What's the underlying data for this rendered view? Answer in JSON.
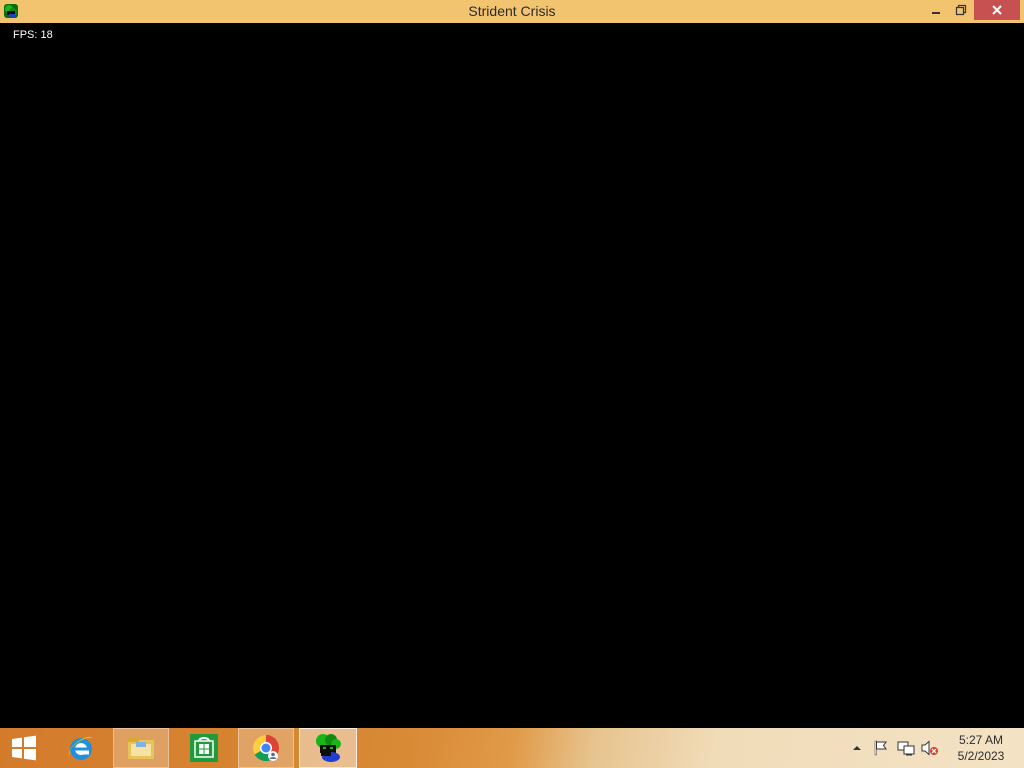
{
  "window": {
    "title": "Strident Crisis",
    "icon": "strident-crisis-app-icon"
  },
  "game": {
    "fps_label": "FPS:",
    "fps_value": "18"
  },
  "taskbar": {
    "start_icon": "windows-start-icon",
    "pinned": [
      {
        "name": "Internet Explorer",
        "icon": "internet-explorer-icon"
      },
      {
        "name": "File Explorer",
        "icon": "file-explorer-icon"
      },
      {
        "name": "Store",
        "icon": "store-icon"
      },
      {
        "name": "Google Chrome",
        "icon": "chrome-icon"
      },
      {
        "name": "Strident Crisis",
        "icon": "strident-crisis-icon"
      }
    ]
  },
  "tray": {
    "time": "5:27 AM",
    "date": "5/2/2023"
  },
  "colors": {
    "titlebar": "#f2c46f",
    "close_button": "#c75050",
    "taskbar_start": "#d37b2b",
    "taskbar_end": "#f3e2c4"
  }
}
